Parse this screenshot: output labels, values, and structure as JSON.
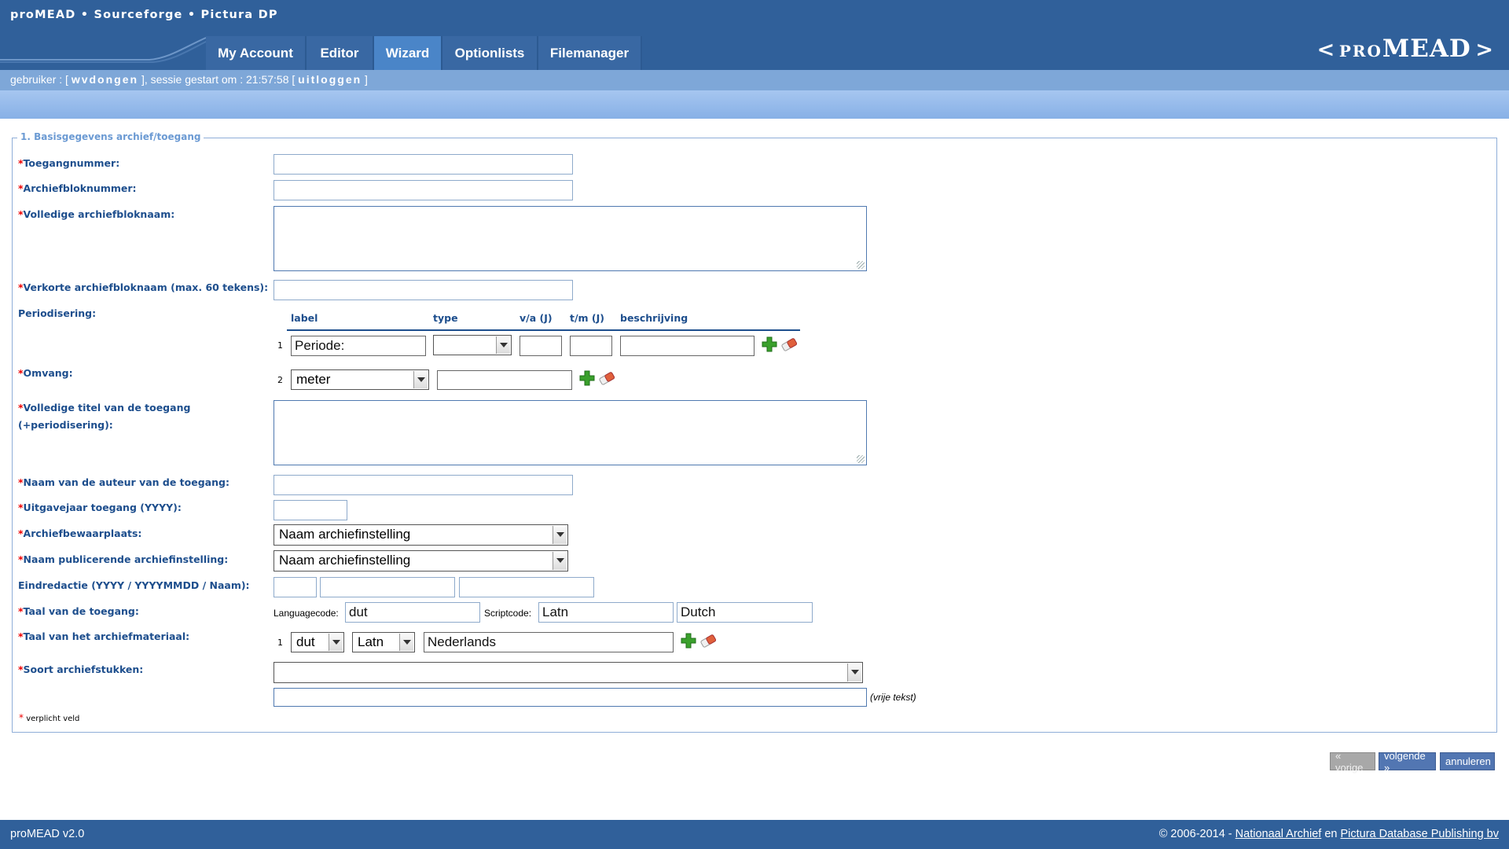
{
  "header": {
    "site_links": "proMEAD • Sourceforge • Pictura DP",
    "nav_tabs": [
      "My Account",
      "Editor",
      "Wizard",
      "Optionlists",
      "Filemanager"
    ],
    "logo_open": "<",
    "logo_small": "PRO",
    "logo_big": "MEAD",
    "logo_close": ">"
  },
  "userbar": {
    "prefix": "gebruiker : [ ",
    "username": "wvdongen",
    "middle": " ], sessie gestart om : 21:57:58 [ ",
    "logout": "uitloggen",
    "suffix": " ]"
  },
  "form": {
    "legend": "1. Basisgegevens archief/toegang",
    "labels": {
      "toegangnummer": "Toegangnummer:",
      "archiefbloknummer": "Archiefbloknummer:",
      "volledige_naam": "Volledige archiefbloknaam:",
      "verkorte_naam": "Verkorte archiefbloknaam (max. 60 tekens):",
      "periodisering": "Periodisering:",
      "omvang": "Omvang:",
      "titel_1": "Volledige titel van de toegang",
      "titel_2": "(+periodisering):",
      "auteur": "Naam van de auteur van de toegang:",
      "uitgavejaar": "Uitgavejaar toegang (YYYY):",
      "bewaarplaats": "Archiefbewaarplaats:",
      "publicerende": "Naam publicerende archiefinstelling:",
      "eindredactie": "Eindredactie (YYYY / YYYYMMDD / Naam):",
      "taal_toegang": "Taal van de toegang:",
      "taal_materiaal": "Taal van het archiefmateriaal:",
      "soort": "Soort archiefstukken:"
    },
    "required_marker": "*",
    "periodisering": {
      "columns": [
        "label",
        "type",
        "v/a (J)",
        "t/m (J)",
        "beschrijving"
      ],
      "row_number": "1",
      "label_value": "Periode:",
      "type_value": "",
      "va_value": "",
      "tm_value": "",
      "beschrijving_value": ""
    },
    "omvang": {
      "row_number": "2",
      "unit": "meter",
      "value": ""
    },
    "bewaarplaats_value": "Naam archiefinstelling",
    "publicerende_value": "Naam archiefinstelling",
    "taal_toegang": {
      "languagecode_label": "Languagecode:",
      "languagecode": "dut",
      "scriptcode_label": "Scriptcode:",
      "scriptcode": "Latn",
      "language_name": "Dutch"
    },
    "taal_materiaal": {
      "row_number": "1",
      "lang": "dut",
      "script": "Latn",
      "name": "Nederlands"
    },
    "soort_value": "",
    "vrije_tekst": "(vrije tekst)",
    "required_note": "verplicht veld"
  },
  "buttons": {
    "prev": "« vorige",
    "next": "volgende »",
    "cancel": "annuleren"
  },
  "footer": {
    "version": "proMEAD v2.0",
    "copyright": "© 2006-2014 - ",
    "link1": "Nationaal Archief",
    "and": " en ",
    "link2": "Pictura Database Publishing bv"
  },
  "icons": [
    "add-icon",
    "eraser-icon",
    "chevron-down-icon"
  ],
  "colors": {
    "header": "#30609a",
    "accent_blue": "#1d4e8d",
    "required": "#e00000",
    "active_tab": "#4a85c8"
  }
}
